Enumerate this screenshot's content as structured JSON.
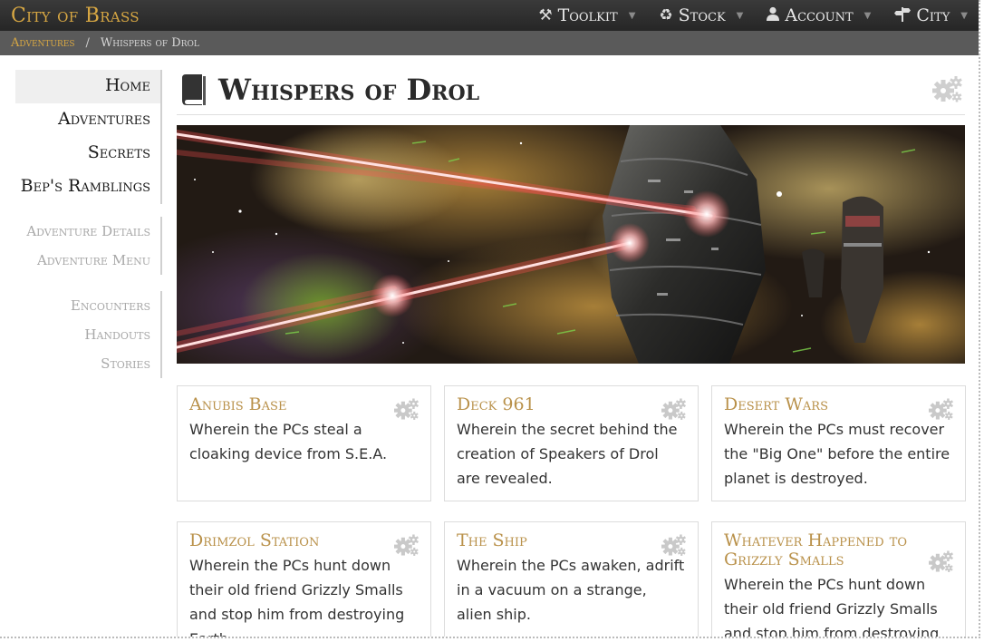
{
  "brand": "City of Brass",
  "topnav": [
    {
      "label": "Toolkit",
      "icon": "tools-icon"
    },
    {
      "label": "Stock",
      "icon": "recycle-icon"
    },
    {
      "label": "Account",
      "icon": "user-icon"
    },
    {
      "label": "City",
      "icon": "signpost-icon"
    }
  ],
  "breadcrumb": {
    "parent": "Adventures",
    "separator": "/",
    "current": "Whispers of Drol"
  },
  "sidenav": {
    "main": [
      "Home",
      "Adventures",
      "Secrets",
      "Bep's Ramblings"
    ],
    "details": [
      "Adventure Details",
      "Adventure Menu"
    ],
    "content": [
      "Encounters",
      "Handouts",
      "Stories"
    ]
  },
  "page": {
    "title": "Whispers of Drol"
  },
  "cards": [
    {
      "title": "Anubis Base",
      "text": "Wherein the PCs steal a cloaking device from S.E.A."
    },
    {
      "title": "Deck 961",
      "text": "Wherein the secret behind the creation of Speakers of Drol are revealed."
    },
    {
      "title": "Desert Wars",
      "text": "Wherein the PCs must recover the \"Big One\" before the entire planet is destroyed."
    },
    {
      "title": "Drimzol Station",
      "text": "Wherein the PCs hunt down their old friend Grizzly Smalls and stop him from destroying Earth."
    },
    {
      "title": "The Ship",
      "text": "Wherein the PCs awaken, adrift in a vacuum on a strange, alien ship."
    },
    {
      "title": "Whatever Happened to Grizzly Smalls",
      "text": "Wherein the PCs hunt down their old friend Grizzly Smalls and stop him from destroying Earth."
    }
  ],
  "colors": {
    "accent": "#d7a743",
    "card_title": "#b9914a",
    "topbar": "#2e2e2e",
    "crumbbar": "#5a5a5a"
  }
}
